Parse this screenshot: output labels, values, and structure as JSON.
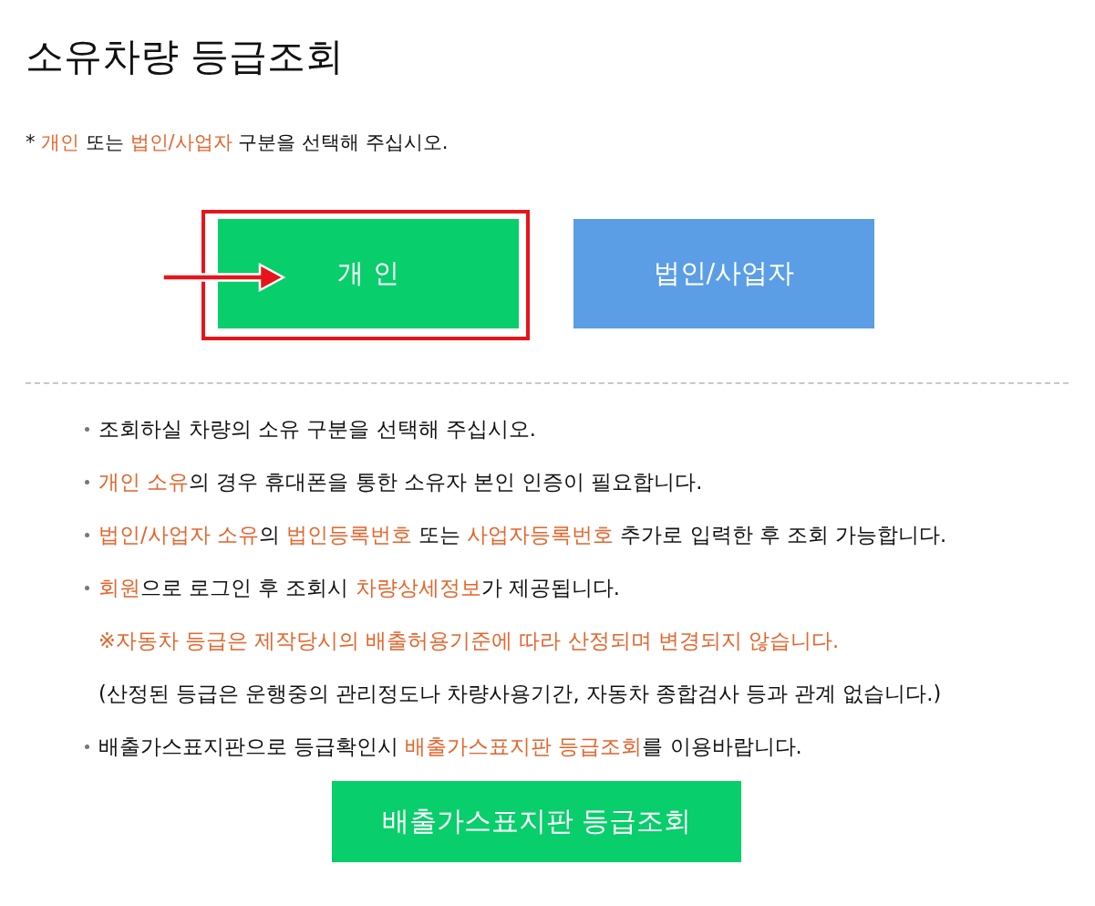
{
  "page_title": "소유차량 등급조회",
  "instruction": {
    "segments": [
      {
        "text": "* ",
        "emphasis": false
      },
      {
        "text": "개인",
        "emphasis": true
      },
      {
        "text": " 또는 ",
        "emphasis": false
      },
      {
        "text": "법인/사업자",
        "emphasis": true
      },
      {
        "text": " 구분을 선택해 주십시오.",
        "emphasis": false
      }
    ]
  },
  "owner_type_buttons": [
    {
      "label": "개 인",
      "color": "#08ce6b",
      "highlighted": true
    },
    {
      "label": "법인/사업자",
      "color": "#5b9ee6",
      "highlighted": false
    }
  ],
  "notices": [
    {
      "kind": "bullet",
      "segments": [
        {
          "text": "조회하실 차량의 소유 구분을 선택해 주십시오.",
          "emphasis": false
        }
      ]
    },
    {
      "kind": "bullet",
      "segments": [
        {
          "text": "개인 소유",
          "emphasis": true
        },
        {
          "text": "의 경우 휴대폰을 통한 소유자 본인 인증이 필요합니다.",
          "emphasis": false
        }
      ]
    },
    {
      "kind": "bullet",
      "segments": [
        {
          "text": "법인/사업자 소유",
          "emphasis": true
        },
        {
          "text": "의 ",
          "emphasis": false
        },
        {
          "text": "법인등록번호",
          "emphasis": true
        },
        {
          "text": " 또는 ",
          "emphasis": false
        },
        {
          "text": "사업자등록번호",
          "emphasis": true
        },
        {
          "text": " 추가로 입력한 후 조회 가능합니다.",
          "emphasis": false
        }
      ]
    },
    {
      "kind": "bullet",
      "segments": [
        {
          "text": "회원",
          "emphasis": true
        },
        {
          "text": "으로 로그인 후 조회시 ",
          "emphasis": false
        },
        {
          "text": "차량상세정보",
          "emphasis": true
        },
        {
          "text": "가 제공됩니다.",
          "emphasis": false
        }
      ]
    },
    {
      "kind": "note",
      "segments": [
        {
          "text": "※자동차 등급은 제작당시의 배출허용기준에 따라 산정되며 변경되지 않습니다.",
          "emphasis": true
        }
      ]
    },
    {
      "kind": "note",
      "segments": [
        {
          "text": "(산정된 등급은 운행중의 관리정도나 차량사용기간, 자동차 종합검사 등과 관계 없습니다.)",
          "emphasis": false
        }
      ]
    },
    {
      "kind": "bullet",
      "segments": [
        {
          "text": "배출가스표지판으로 등급확인시 ",
          "emphasis": false
        },
        {
          "text": "배출가스표지판 등급조회",
          "emphasis": true
        },
        {
          "text": "를 이용바랍니다.",
          "emphasis": false
        }
      ]
    }
  ],
  "lookup_button": {
    "label": "배출가스표지판 등급조회"
  }
}
